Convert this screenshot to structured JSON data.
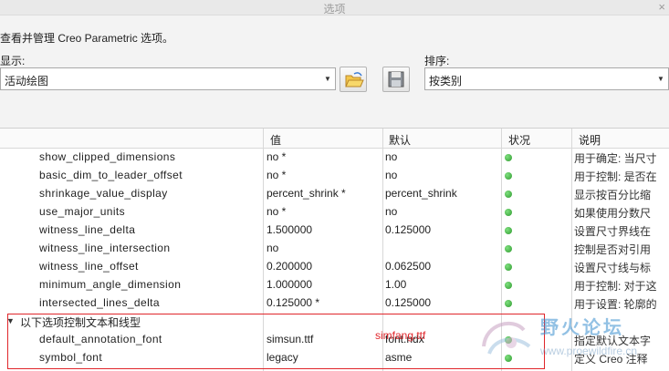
{
  "window": {
    "title": "选项",
    "close_glyph": "×"
  },
  "description": "查看并管理 Creo Parametric 选项。",
  "display": {
    "label": "显示:",
    "value": "活动绘图"
  },
  "sort": {
    "label": "排序:",
    "value": "按类别"
  },
  "table": {
    "headers": {
      "value": "值",
      "default": "默认",
      "status": "状况",
      "explanation": "说明"
    },
    "rows": [
      {
        "name": "show_clipped_dimensions",
        "value": "no *",
        "default": "no",
        "explanation": "用于确定: 当尺寸"
      },
      {
        "name": "basic_dim_to_leader_offset",
        "value": "no *",
        "default": "no",
        "explanation": "用于控制: 是否在"
      },
      {
        "name": "shrinkage_value_display",
        "value": "percent_shrink *",
        "default": "percent_shrink",
        "explanation": "显示按百分比缩"
      },
      {
        "name": "use_major_units",
        "value": "no *",
        "default": "no",
        "explanation": "如果使用分数尺"
      },
      {
        "name": "witness_line_delta",
        "value": "1.500000",
        "default": "0.125000",
        "explanation": "设置尺寸界线在"
      },
      {
        "name": "witness_line_intersection",
        "value": "no",
        "default": "",
        "explanation": "控制是否对引用"
      },
      {
        "name": "witness_line_offset",
        "value": "0.200000",
        "default": "0.062500",
        "explanation": "设置尺寸线与标"
      },
      {
        "name": "minimum_angle_dimension",
        "value": "1.000000",
        "default": "1.00",
        "explanation": "用于控制: 对于这"
      },
      {
        "name": "intersected_lines_delta",
        "value": "0.125000 *",
        "default": "0.125000",
        "explanation": "用于设置: 轮廓的"
      }
    ],
    "group": {
      "label": "以下选项控制文本和线型"
    },
    "group_rows": [
      {
        "name": "default_annotation_font",
        "value": "simsun.ttf",
        "default": "font.ndx",
        "explanation": "指定默认文本字"
      },
      {
        "name": "symbol_font",
        "value": "legacy",
        "default": "asme",
        "explanation": "定义 Creo 注释"
      }
    ]
  },
  "annotation": {
    "text": "simfang.ttf",
    "color": "#e0262b"
  },
  "watermark": {
    "text": "野火论坛",
    "url": "www.proewildfire.cn"
  },
  "colors": {
    "status_ok": "#3bb03b"
  }
}
